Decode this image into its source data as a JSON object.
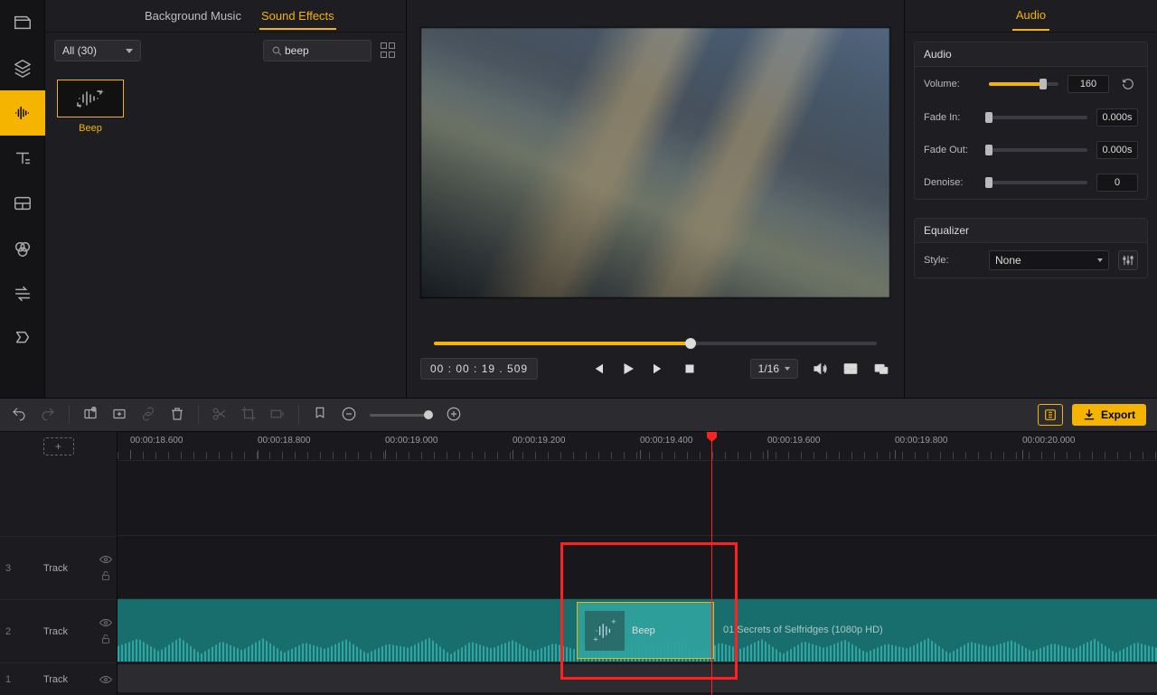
{
  "browser": {
    "tabs": {
      "bgm": "Background Music",
      "sfx": "Sound Effects"
    },
    "filter_label": "All (30)",
    "search_value": "beep",
    "asset_name": "Beep"
  },
  "preview": {
    "timecode": "00 : 00 : 19 . 509",
    "ratio": "1/16"
  },
  "inspector": {
    "tab": "Audio",
    "group_audio": "Audio",
    "group_eq": "Equalizer",
    "labels": {
      "volume": "Volume:",
      "fadein": "Fade In:",
      "fadeout": "Fade Out:",
      "denoise": "Denoise:",
      "style": "Style:"
    },
    "values": {
      "volume": "160",
      "fadein": "0.000s",
      "fadeout": "0.000s",
      "denoise": "0",
      "style": "None"
    }
  },
  "toolbar": {
    "export": "Export"
  },
  "timeline": {
    "ticks": [
      "00:00:18.600",
      "00:00:18.800",
      "00:00:19.000",
      "00:00:19.200",
      "00:00:19.400",
      "00:00:19.600",
      "00:00:19.800",
      "00:00:20.000"
    ],
    "tracks": {
      "t3": {
        "num": "3",
        "label": "Track"
      },
      "t2": {
        "num": "2",
        "label": "Track"
      },
      "t1": {
        "num": "1",
        "label": "Track"
      }
    },
    "clip_label": "Beep",
    "main_clip_label": "01 Secrets of Selfridges (1080p HD)"
  }
}
